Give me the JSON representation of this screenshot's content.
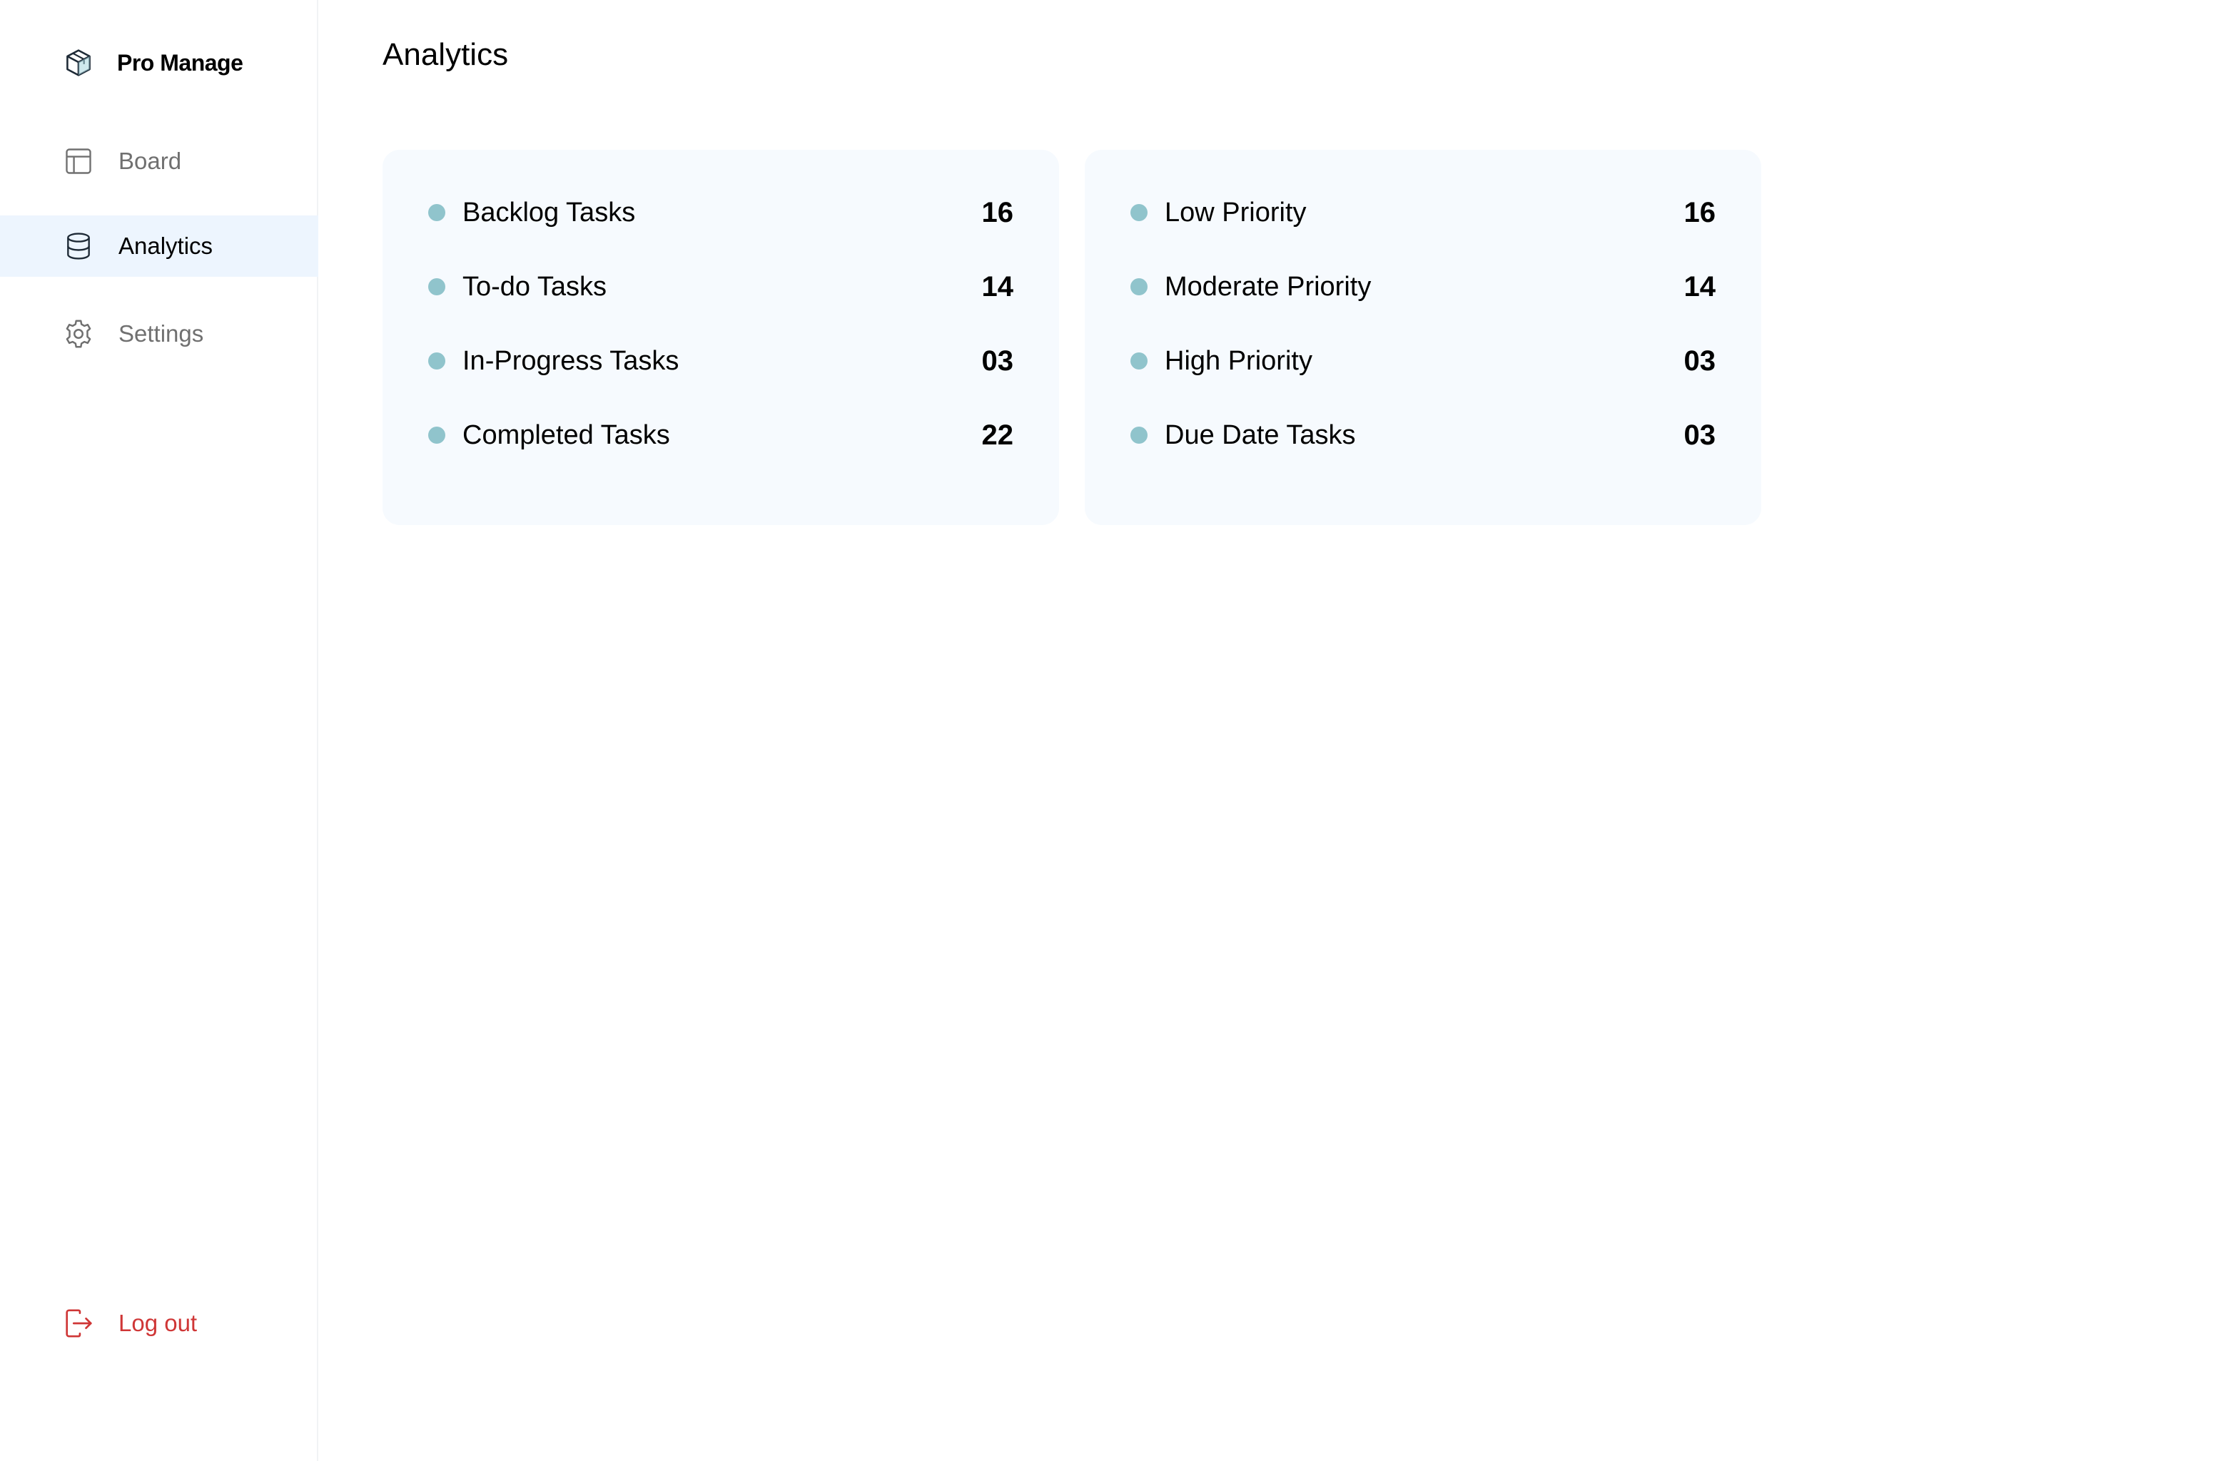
{
  "brand": {
    "name": "Pro Manage",
    "icon": "cube-icon"
  },
  "sidebar": {
    "items": [
      {
        "label": "Board",
        "icon": "layout-icon",
        "active": false
      },
      {
        "label": "Analytics",
        "icon": "database-icon",
        "active": true
      },
      {
        "label": "Settings",
        "icon": "gear-icon",
        "active": false
      }
    ],
    "logout": {
      "label": "Log out",
      "icon": "logout-icon"
    }
  },
  "page": {
    "title": "Analytics"
  },
  "cards": {
    "status": [
      {
        "label": "Backlog Tasks",
        "value": "16"
      },
      {
        "label": "To-do Tasks",
        "value": "14"
      },
      {
        "label": "In-Progress Tasks",
        "value": "03"
      },
      {
        "label": "Completed Tasks",
        "value": "22"
      }
    ],
    "priority": [
      {
        "label": "Low Priority",
        "value": "16"
      },
      {
        "label": "Moderate Priority",
        "value": "14"
      },
      {
        "label": "High Priority",
        "value": "03"
      },
      {
        "label": "Due Date Tasks",
        "value": "03"
      }
    ]
  },
  "colors": {
    "accent_dot": "#90c4cc",
    "active_nav_bg": "#edf5fe",
    "card_bg": "#f6fafe",
    "logout_red": "#cf3636",
    "muted_text": "#707070"
  }
}
